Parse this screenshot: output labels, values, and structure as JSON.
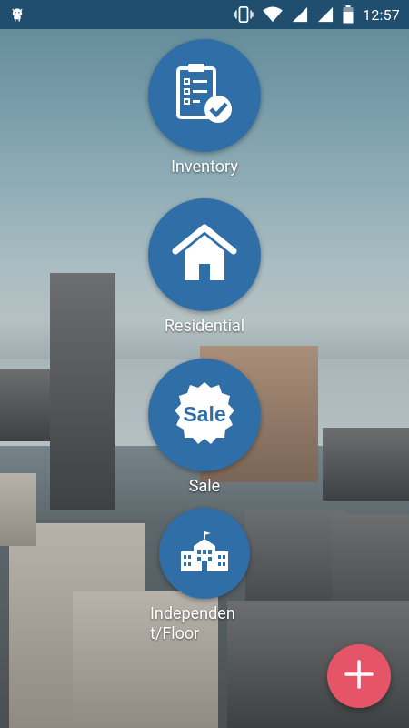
{
  "status_bar": {
    "time": "12:57",
    "icons": [
      "android-debug-icon",
      "vibrate-icon",
      "wifi-icon",
      "signal-icon",
      "battery-icon"
    ]
  },
  "menu": {
    "items": [
      {
        "label": "Inventory",
        "icon": "clipboard-check-icon"
      },
      {
        "label": "Residential",
        "icon": "house-icon"
      },
      {
        "label": "Sale",
        "icon": "sale-badge-icon",
        "badge_text": "Sale"
      },
      {
        "label": "Independent/Floor",
        "label_line1": "Independen",
        "label_line2": "t/Floor",
        "icon": "building-icon"
      }
    ]
  },
  "fab": {
    "icon": "plus-icon"
  },
  "colors": {
    "status_bar": "#1f4e6f",
    "circle": "#2f6ea6",
    "fab": "#e65567"
  }
}
